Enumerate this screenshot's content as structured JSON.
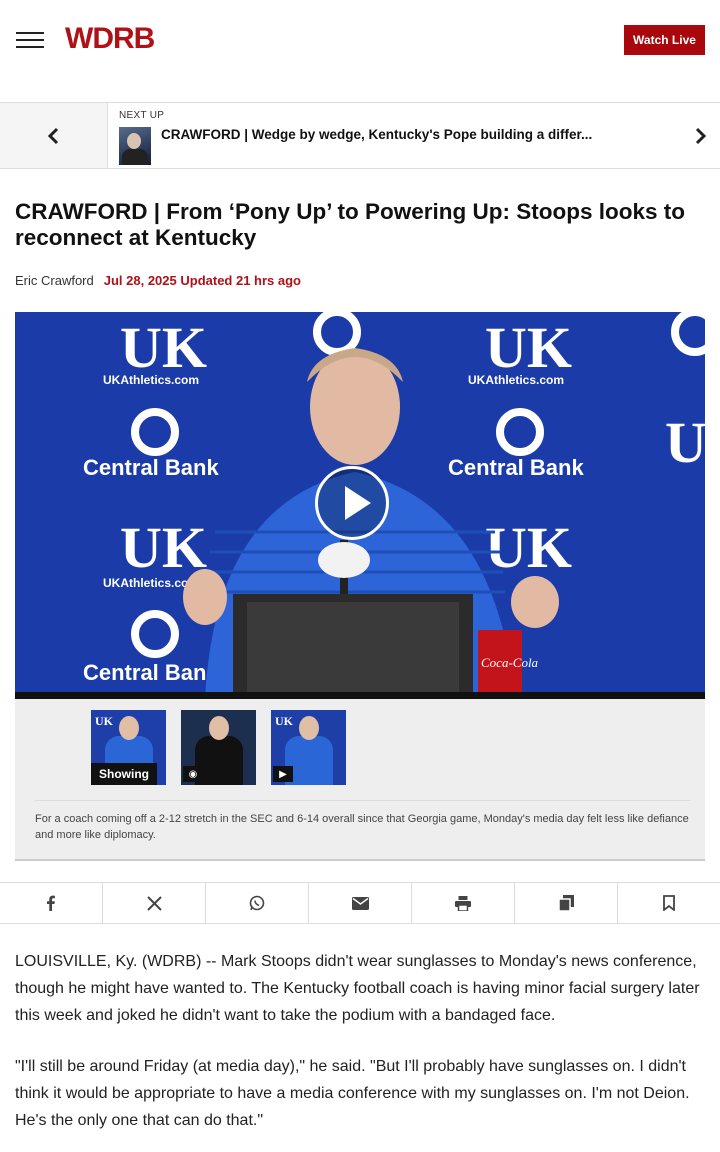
{
  "header": {
    "logo": "WDRB",
    "watch_live": "Watch Live"
  },
  "next_up": {
    "label": "NEXT UP",
    "title": "CRAWFORD | Wedge by wedge, Kentucky's Pope building a differ..."
  },
  "article": {
    "headline": "CRAWFORD | From ‘Pony Up’ to Powering Up: Stoops looks to reconnect at Kentucky",
    "author": "Eric Crawford",
    "date": "Jul 28, 2025 Updated 21 hrs ago",
    "paragraphs": [
      "LOUISVILLE, Ky. (WDRB) -- Mark Stoops didn't wear sunglasses to Monday's news conference, though he might have wanted to. The Kentucky football coach is having minor facial surgery later this week and joked he didn't want to take the podium with a bandaged face.",
      "\"I'll still be around Friday (at media day),\" he said. \"But I'll probably have sunglasses on. I didn't think it would be appropriate to have a media conference with my sunglasses on. I'm not Deion. He's the only one that can do that.\""
    ]
  },
  "media": {
    "backdrop_texts": [
      "UKAthletics.com",
      "Central Bank"
    ],
    "showing_label": "Showing",
    "caption": "For a coach coming off a 2-12 stretch in the SEC and 6-14 overall since that Georgia game, Monday's media day felt less like defiance and more like diplomacy."
  },
  "share_icons": [
    "facebook-icon",
    "x-icon",
    "whatsapp-icon",
    "email-icon",
    "print-icon",
    "copy-icon",
    "bookmark-icon"
  ],
  "colors": {
    "brand_red": "#b01117",
    "watch_live_bg": "#a8070d",
    "backdrop_blue": "#1b3ca8"
  }
}
